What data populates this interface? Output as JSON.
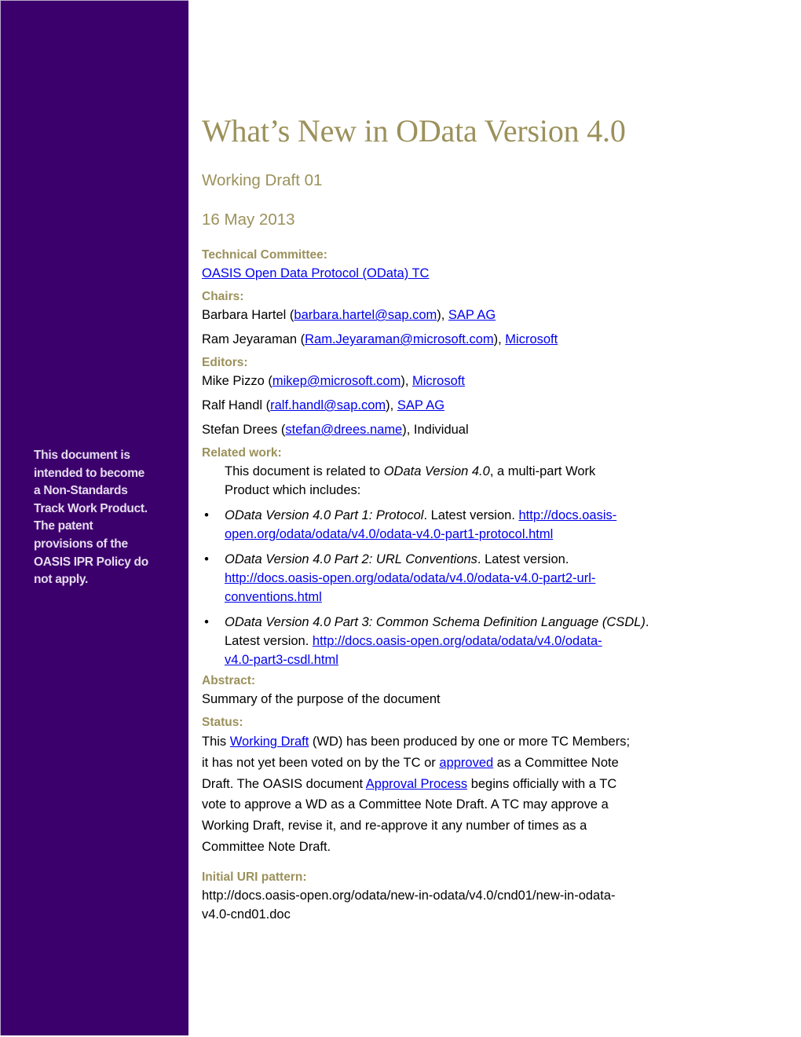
{
  "sidebar": {
    "note": "This document is intended to become a Non-Standards Track Work Product. The patent provisions of the OASIS IPR Policy do not apply.",
    "note_lines": [
      "This document is",
      "intended to become",
      "a Non-Standards",
      "Track Work Product.",
      "The patent",
      "provisions of the",
      "OASIS IPR Policy do",
      "not apply."
    ],
    "color": "#3c006c"
  },
  "header": {
    "title": "What’s New in OData Version 4.0",
    "stage": "Working Draft 01",
    "date": "16 May 2013",
    "accent_color": "#9b915b"
  },
  "technical_committee": {
    "label": "Technical Committee:",
    "link": "OASIS Open Data Protocol (OData) TC"
  },
  "chairs": {
    "label": "Chairs:",
    "people": [
      {
        "name": "Barbara Hartel",
        "email": "barbara.hartel@sap.com",
        "org": "SAP AG"
      },
      {
        "name": "Ram Jeyaraman",
        "email": "Ram.Jeyaraman@microsoft.com",
        "org": "Microsoft"
      }
    ]
  },
  "editors": {
    "label": "Editors:",
    "people": [
      {
        "name": "Mike Pizzo",
        "email": "mikep@microsoft.com",
        "org": "Microsoft"
      },
      {
        "name": "Ralf Handl",
        "email": "ralf.handl@sap.com",
        "org": "SAP AG"
      },
      {
        "name": "Stefan Drees",
        "email": "stefan@drees.name",
        "org": "Individual"
      }
    ]
  },
  "related_work": {
    "label": "Related work:",
    "intro_pre": "This document is related to ",
    "intro_em": "OData Version 4.0",
    "intro_post_line1": ", a multi-part Work",
    "intro_line2": "Product which includes:",
    "parts": [
      {
        "title": "OData Version 4.0 Part 1: Protocol",
        "suffix": ". Latest version. ",
        "url_line1": "http://docs.oasis-",
        "url_line2": "open.org/odata/odata/v4.0/odata-v4.0-part1-protocol.html"
      },
      {
        "title": "OData Version 4.0 Part 2: URL Conventions",
        "suffix": ". Latest version.",
        "url_line1": "http://docs.oasis-open.org/odata/odata/v4.0/odata-v4.0-part2-url-",
        "url_line2": "conventions.html"
      },
      {
        "title": "OData Version 4.0 Part 3: Common Schema Definition Language (CSDL)",
        "suffix": ".",
        "prefix_line2": "Latest version. ",
        "url_line1": "http://docs.oasis-open.org/odata/odata/v4.0/odata-",
        "url_line2": "v4.0-part3-csdl.html"
      }
    ]
  },
  "abstract": {
    "label": "Abstract:",
    "text": "Summary of the purpose of the document"
  },
  "status": {
    "label": "Status:",
    "l1_pre": "This ",
    "l1_link": "Working Draft",
    "l1_post": " (WD) has been produced by one or more TC Members;",
    "l2_pre": "it has not yet been voted on by the TC or ",
    "l2_link": "approved",
    "l2_post": " as a Committee Note",
    "l3_pre": "Draft. The OASIS document ",
    "l3_link": "Approval Process",
    "l3_post": " begins officially with a TC",
    "l4": "vote to approve a WD as a Committee Note Draft. A TC may approve a",
    "l5": "Working Draft, revise it, and re-approve it any number of times as a",
    "l6": "Committee Note Draft."
  },
  "uri_pattern": {
    "label": "Initial URI pattern:",
    "line1": "http://docs.oasis-open.org/odata/new-in-odata/v4.0/cnd01/new-in-odata-",
    "line2": "v4.0-cnd01.doc"
  },
  "bullet_glyph": "•"
}
